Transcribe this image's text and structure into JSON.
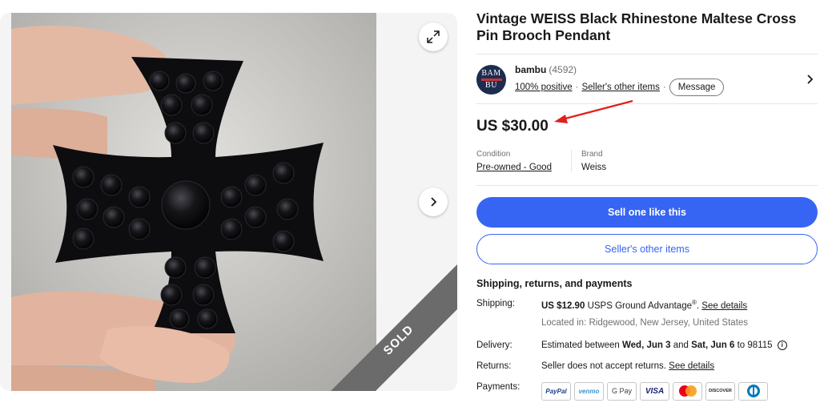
{
  "gallery": {
    "ribbon_text": "SOLD"
  },
  "item": {
    "title": "Vintage WEISS Black Rhinestone Maltese Cross Pin Brooch Pendant",
    "price": "US $30.00"
  },
  "seller": {
    "avatar_line1": "BAM",
    "avatar_line2": "BU",
    "name": "bambu",
    "count": "(4592)",
    "positive": "100% positive",
    "dot1": "·",
    "other_items": "Seller's other items",
    "dot2": "·",
    "message_label": "Message"
  },
  "attributes": {
    "condition_label": "Condition",
    "condition_value": "Pre-owned - Good",
    "brand_label": "Brand",
    "brand_value": "Weiss"
  },
  "actions": {
    "sell_label": "Sell one like this",
    "other_items_label": "Seller's other items"
  },
  "shipping": {
    "heading": "Shipping, returns, and payments",
    "shipping_label": "Shipping:",
    "shipping_cost": "US $12.90",
    "shipping_service": "USPS Ground Advantage",
    "shipping_reg": "®",
    "shipping_period": ". ",
    "see_details": "See details",
    "location": "Located in: Ridgewood, New Jersey, United States",
    "delivery_label": "Delivery:",
    "delivery_prefix": "Estimated between ",
    "delivery_start": "Wed, Jun 3",
    "delivery_and": " and ",
    "delivery_end": "Sat, Jun 6",
    "delivery_suffix": " to 98115",
    "returns_label": "Returns:",
    "returns_text": "Seller does not accept returns. ",
    "returns_link": "See details",
    "payments_label": "Payments:"
  },
  "payments": {
    "paypal": "PayPal",
    "venmo": "venmo",
    "gpay": "G Pay",
    "visa": "VISA",
    "discover": "DISCOVER"
  },
  "colors": {
    "primary": "#3665f3",
    "arrow": "#e0201b",
    "ribbon": "#6b6b6b"
  }
}
